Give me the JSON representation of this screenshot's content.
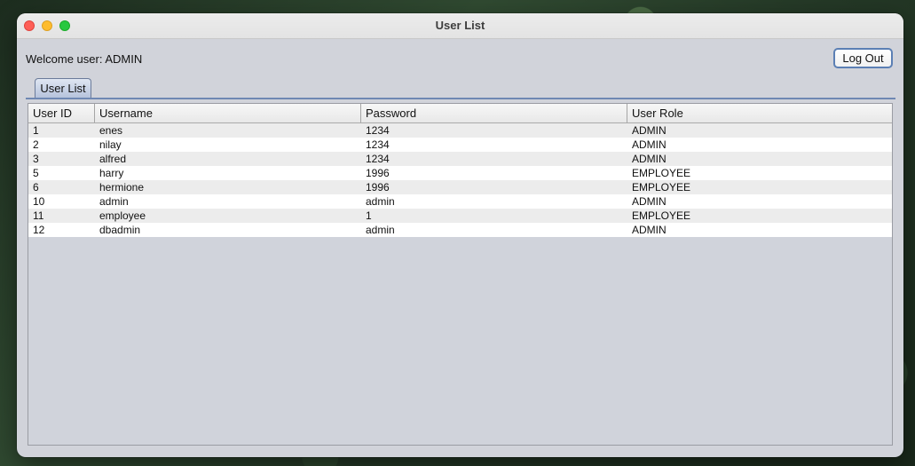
{
  "window": {
    "title": "User List"
  },
  "header": {
    "welcome_text": "Welcome user: ADMIN",
    "logout_label": "Log Out"
  },
  "tabs": [
    {
      "label": "User List"
    }
  ],
  "table": {
    "columns": [
      "User ID",
      "Username",
      "Password",
      "User Role"
    ],
    "rows": [
      [
        "1",
        "enes",
        "1234",
        "ADMIN"
      ],
      [
        "2",
        "nilay",
        "1234",
        "ADMIN"
      ],
      [
        "3",
        "alfred",
        "1234",
        "ADMIN"
      ],
      [
        "5",
        "harry",
        "1996",
        "EMPLOYEE"
      ],
      [
        "6",
        "hermione",
        "1996",
        "EMPLOYEE"
      ],
      [
        "10",
        "admin",
        "admin",
        "ADMIN"
      ],
      [
        "11",
        "employee",
        "1",
        "EMPLOYEE"
      ],
      [
        "12",
        "dbadmin",
        "admin",
        "ADMIN"
      ]
    ]
  }
}
